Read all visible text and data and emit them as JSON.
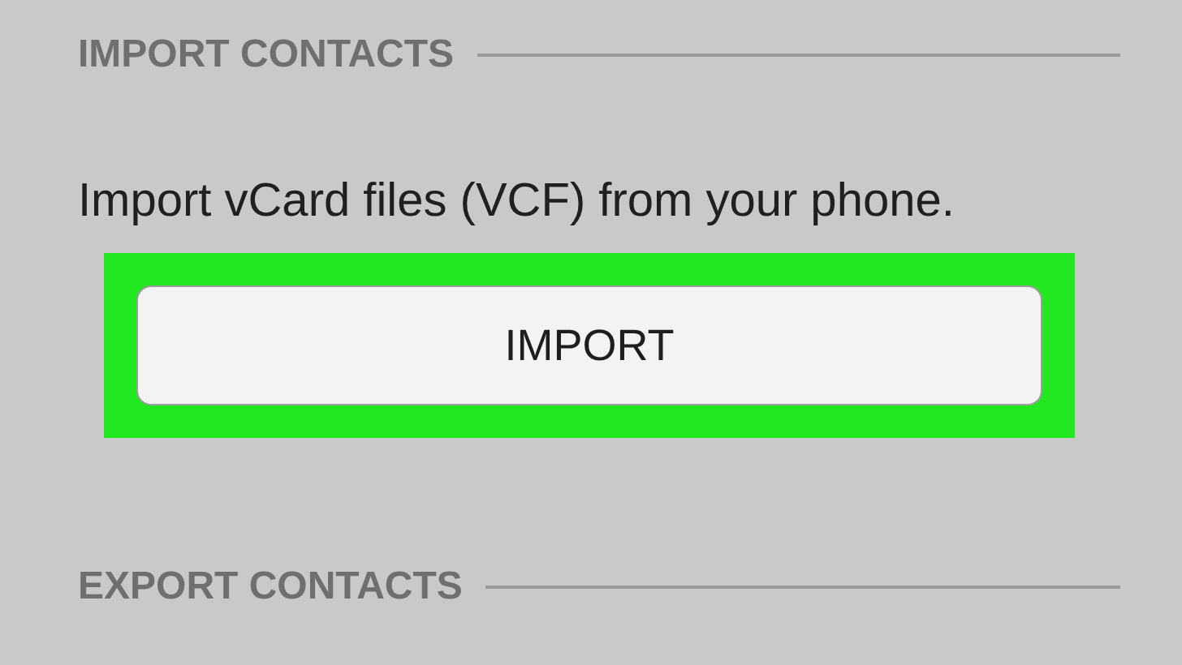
{
  "sections": [
    {
      "heading": "IMPORT CONTACTS",
      "description": "Import vCard files (VCF) from your phone.",
      "button": {
        "label": "IMPORT",
        "highlighted": true
      }
    },
    {
      "heading": "EXPORT CONTACTS"
    }
  ]
}
